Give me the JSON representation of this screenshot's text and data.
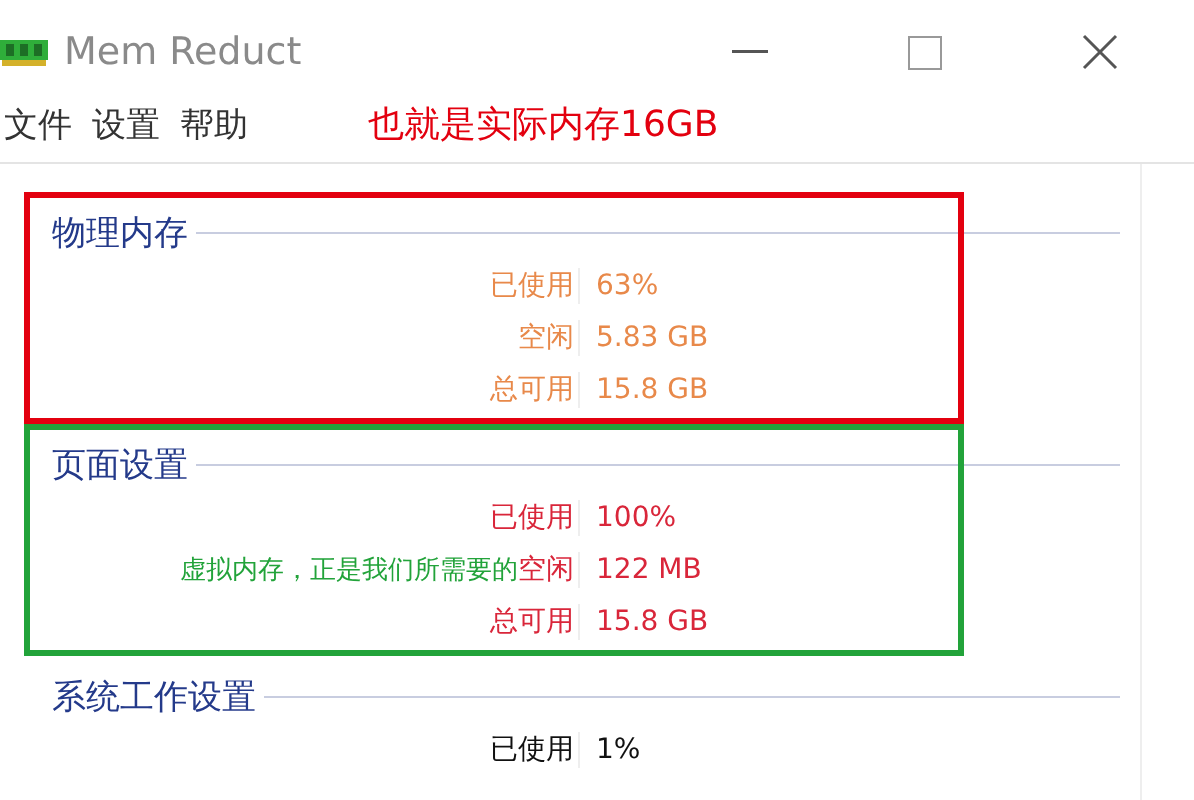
{
  "window": {
    "title": "Mem Reduct"
  },
  "menu": [
    {
      "label": "文件"
    },
    {
      "label": "设置"
    },
    {
      "label": "帮助"
    }
  ],
  "annotation": {
    "text": "也就是实际内存16GB",
    "color": "#e3000f"
  },
  "groups": [
    {
      "title": "物理内存",
      "color": "#e8894a",
      "highlight": {
        "color": "#e3000f"
      },
      "rows": [
        {
          "label": "已使用",
          "value": "63%"
        },
        {
          "label": "空闲",
          "value": "5.83 GB"
        },
        {
          "label": "总可用",
          "value": "15.8 GB"
        }
      ]
    },
    {
      "title": "页面设置",
      "color": "#d9263a",
      "highlight": {
        "color": "#22a33a"
      },
      "rows": [
        {
          "label": "已使用",
          "value": "100%"
        },
        {
          "label": "空闲",
          "value": "122 MB",
          "note": "虚拟内存，正是我们所需要的"
        },
        {
          "label": "总可用",
          "value": "15.8 GB"
        }
      ]
    },
    {
      "title": "系统工作设置",
      "color": "#111111",
      "rows": [
        {
          "label": "已使用",
          "value": "1%"
        }
      ]
    }
  ]
}
